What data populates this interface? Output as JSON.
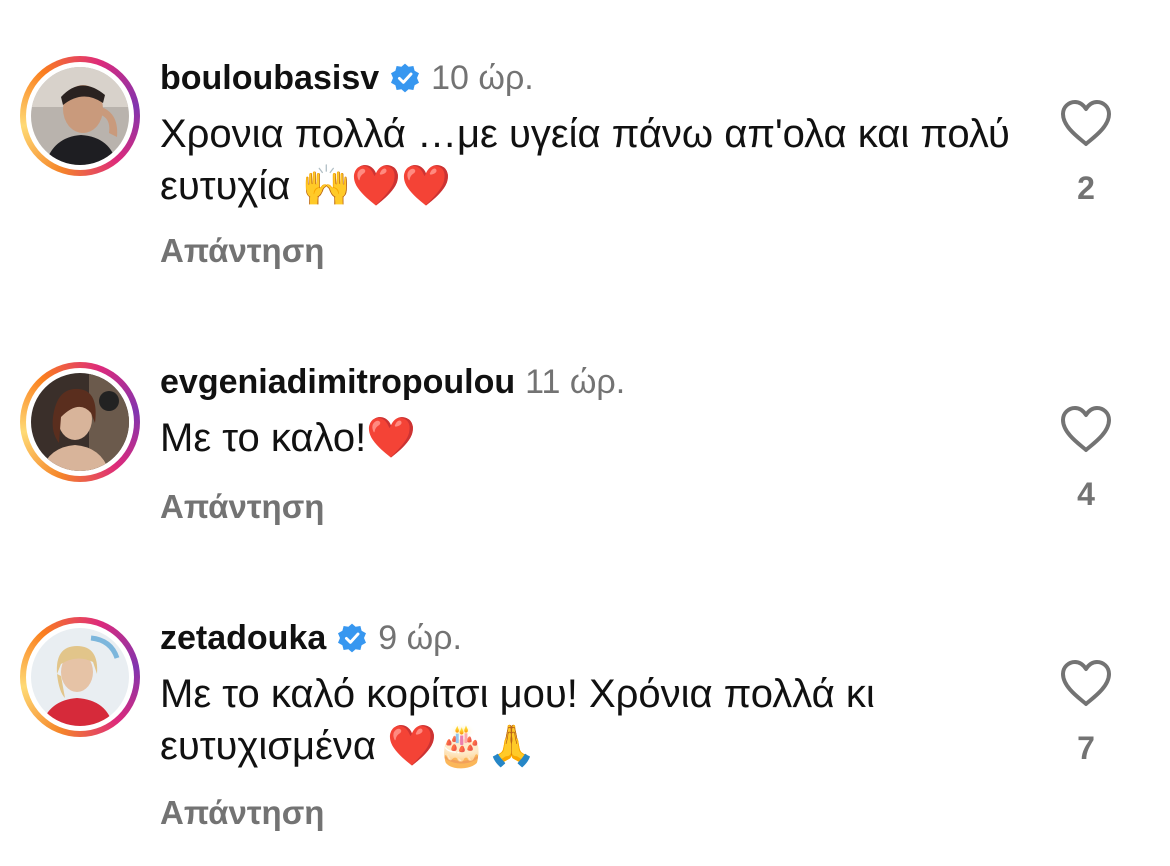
{
  "colors": {
    "accent_verified": "#3797f0",
    "secondary_text": "#737373",
    "primary_text": "#111111"
  },
  "icons": {
    "verified": "verified-badge-icon",
    "like": "heart-outline-icon"
  },
  "comments": [
    {
      "username": "bouloubasisv",
      "verified": true,
      "time": "10 ώρ.",
      "text": "Χρονια πολλά …με υγεία πάνω απ'ολα και πολύ ευτυχία 🙌❤️❤️",
      "reply_label": "Απάντηση",
      "like_count": "2"
    },
    {
      "username": "evgeniadimitropoulou",
      "verified": false,
      "time": "11 ώρ.",
      "text": "Με το καλο!❤️",
      "reply_label": "Απάντηση",
      "like_count": "4"
    },
    {
      "username": "zetadouka",
      "verified": true,
      "time": "9 ώρ.",
      "text": "Με το καλό κορίτσι μου! Χρόνια πολλά κι ευτυχισμένα ❤️🎂🙏",
      "reply_label": "Απάντηση",
      "like_count": "7"
    }
  ]
}
